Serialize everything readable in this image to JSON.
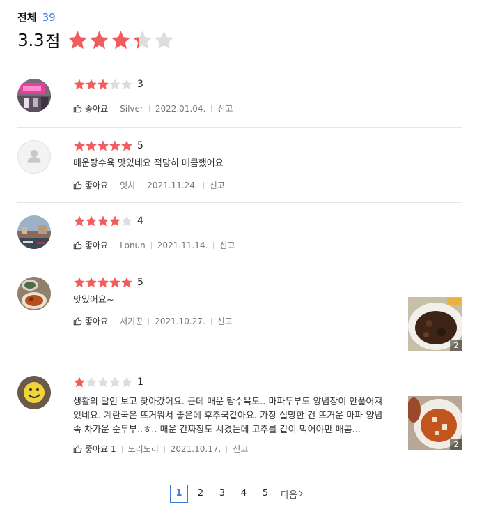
{
  "header": {
    "total_label": "전체",
    "total_count": "39",
    "score": "3.3",
    "score_unit": "점",
    "score_value": 3.3
  },
  "colors": {
    "star_on": "#f25c5c",
    "star_off": "#dddddd",
    "accent": "#3a7bd5"
  },
  "reviews": [
    {
      "rating": 3,
      "score": "3",
      "text": "",
      "like": "좋아요",
      "user": "Silver",
      "date": "2022.01.04.",
      "report": "신고",
      "avatar": "pink-store-photo"
    },
    {
      "rating": 5,
      "score": "5",
      "text": "매운탕수육 맛있네요 적당히 매콤했어요",
      "like": "좋아요",
      "user": "잇치",
      "date": "2021.11.24.",
      "report": "신고",
      "avatar": "default-person-icon"
    },
    {
      "rating": 4,
      "score": "4",
      "text": "",
      "like": "좋아요",
      "user": "Lonun",
      "date": "2021.11.14.",
      "report": "신고",
      "avatar": "harbor-photo"
    },
    {
      "rating": 5,
      "score": "5",
      "text": "맛있어요~",
      "like": "좋아요",
      "user": "서기꾼",
      "date": "2021.10.27.",
      "report": "신고",
      "avatar": "food-photo",
      "photo_count": "2"
    },
    {
      "rating": 1,
      "score": "1",
      "text": "생활의 달인 보고 찾아갔어요. 근데 매운 탕수육도.. 마파두부도 양념장이 안풀어져있네요. 계란국은 뜨거워서 좋은데 후추국같아요. 가장 실망한 건 뜨거운 마파 양념속 차가운 순두부..ㅎ.. 매운 간짜장도 시켰는데 고추를 같이 먹어야만 매콤...",
      "like": "좋아요 1",
      "user": "도리도리",
      "date": "2021.10.17.",
      "report": "신고",
      "avatar": "smiley-photo",
      "photo_count": "2"
    }
  ],
  "pagination": {
    "pages": [
      "1",
      "2",
      "3",
      "4",
      "5"
    ],
    "current": "1",
    "next_label": "다음"
  }
}
